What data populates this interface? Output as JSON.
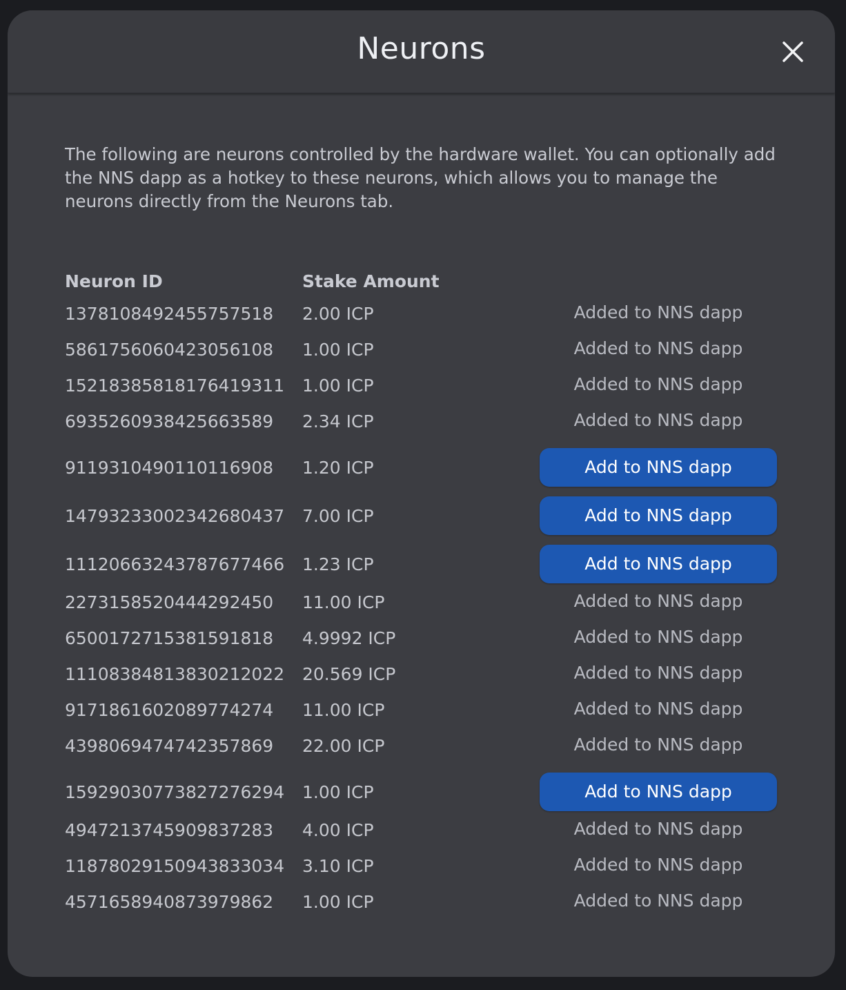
{
  "modal": {
    "title": "Neurons",
    "close_icon": "close-icon",
    "intro": "The following are neurons controlled by the hardware wallet. You can optionally add the NNS dapp as a hotkey to these neurons, which allows you to manage the neurons directly from the Neurons tab."
  },
  "table": {
    "headers": {
      "neuron_id": "Neuron ID",
      "stake_amount": "Stake Amount"
    },
    "rows": [
      {
        "id": "1378108492455757518",
        "stake": "2.00 ICP",
        "status": "Added to NNS dapp",
        "action": null
      },
      {
        "id": "5861756060423056108",
        "stake": "1.00 ICP",
        "status": "Added to NNS dapp",
        "action": null
      },
      {
        "id": "15218385818176419311",
        "stake": "1.00 ICP",
        "status": "Added to NNS dapp",
        "action": null
      },
      {
        "id": "6935260938425663589",
        "stake": "2.34 ICP",
        "status": "Added to NNS dapp",
        "action": null
      },
      {
        "id": "9119310490110116908",
        "stake": "1.20 ICP",
        "status": null,
        "action": "Add to NNS dapp"
      },
      {
        "id": "14793233002342680437",
        "stake": "7.00 ICP",
        "status": null,
        "action": "Add to NNS dapp"
      },
      {
        "id": "11120663243787677466",
        "stake": "1.23 ICP",
        "status": null,
        "action": "Add to NNS dapp"
      },
      {
        "id": "2273158520444292450",
        "stake": "11.00 ICP",
        "status": "Added to NNS dapp",
        "action": null
      },
      {
        "id": "6500172715381591818",
        "stake": "4.9992 ICP",
        "status": "Added to NNS dapp",
        "action": null
      },
      {
        "id": "11108384813830212022",
        "stake": "20.569 ICP",
        "status": "Added to NNS dapp",
        "action": null
      },
      {
        "id": "9171861602089774274",
        "stake": "11.00 ICP",
        "status": "Added to NNS dapp",
        "action": null
      },
      {
        "id": "4398069474742357869",
        "stake": "22.00 ICP",
        "status": "Added to NNS dapp",
        "action": null
      },
      {
        "id": "15929030773827276294",
        "stake": "1.00 ICP",
        "status": null,
        "action": "Add to NNS dapp"
      },
      {
        "id": "4947213745909837283",
        "stake": "4.00 ICP",
        "status": "Added to NNS dapp",
        "action": null
      },
      {
        "id": "11878029150943833034",
        "stake": "3.10 ICP",
        "status": "Added to NNS dapp",
        "action": null
      },
      {
        "id": "4571658940873979862",
        "stake": "1.00 ICP",
        "status": "Added to NNS dapp",
        "action": null
      }
    ]
  },
  "colors": {
    "modal_background": "#3c3d42",
    "button_background": "#1d58b2",
    "text_primary": "#eef0f4",
    "text_secondary": "#c6c8ce"
  }
}
